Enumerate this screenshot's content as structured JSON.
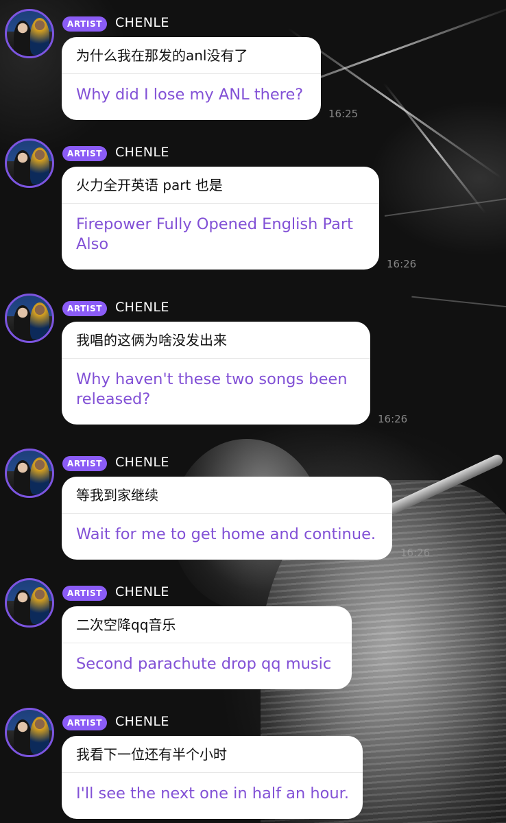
{
  "sender": {
    "badge": "ARTIST",
    "name": "CHENLE"
  },
  "messages": [
    {
      "original": "为什么我在那发的anl没有了",
      "translation": "Why did I lose my ANL there?",
      "time": "16:25"
    },
    {
      "original": "火力全开英语 part 也是",
      "translation": "Firepower Fully Opened English Part Also",
      "time": "16:26"
    },
    {
      "original": "我唱的这俩为啥没发出来",
      "translation": "Why haven't these two songs been released?",
      "time": "16:26"
    },
    {
      "original": "等我到家继续",
      "translation": "Wait for me to get home and continue.",
      "time": "16:26"
    },
    {
      "original": "二次空降qq音乐",
      "translation": "Second parachute drop qq music",
      "time": ""
    },
    {
      "original": "我看下一位还有半个小时",
      "translation": "I'll see the next one in half an hour.",
      "time": ""
    }
  ],
  "colors": {
    "badge": "#8b5cf6",
    "translation_text": "#8251d6",
    "avatar_ring": "#7c55e0",
    "bubble": "#ffffff"
  }
}
